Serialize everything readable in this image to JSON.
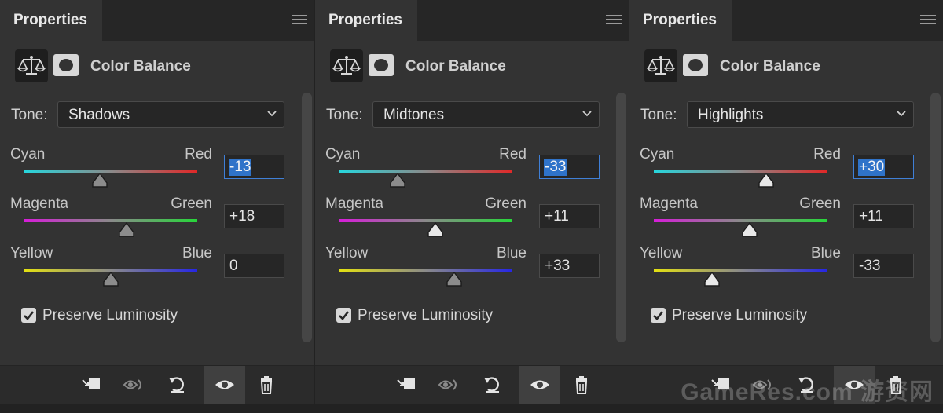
{
  "panels": [
    {
      "tab_title": "Properties",
      "adjustment_title": "Color Balance",
      "tone_label": "Tone:",
      "tone_value": "Shadows",
      "sliders": [
        {
          "left": "Cyan",
          "right": "Red",
          "value": "-13",
          "level": 0.435,
          "focused": true
        },
        {
          "left": "Magenta",
          "right": "Green",
          "value": "+18",
          "level": 0.59,
          "focused": false
        },
        {
          "left": "Yellow",
          "right": "Blue",
          "value": "0",
          "level": 0.5,
          "focused": false
        }
      ],
      "preserve_label": "Preserve Luminosity",
      "preserve_checked": true
    },
    {
      "tab_title": "Properties",
      "adjustment_title": "Color Balance",
      "tone_label": "Tone:",
      "tone_value": "Midtones",
      "sliders": [
        {
          "left": "Cyan",
          "right": "Red",
          "value": "-33",
          "level": 0.335,
          "focused": true
        },
        {
          "left": "Magenta",
          "right": "Green",
          "value": "+11",
          "level": 0.555,
          "focused": false
        },
        {
          "left": "Yellow",
          "right": "Blue",
          "value": "+33",
          "level": 0.665,
          "focused": false
        }
      ],
      "preserve_label": "Preserve Luminosity",
      "preserve_checked": true
    },
    {
      "tab_title": "Properties",
      "adjustment_title": "Color Balance",
      "tone_label": "Tone:",
      "tone_value": "Highlights",
      "sliders": [
        {
          "left": "Cyan",
          "right": "Red",
          "value": "+30",
          "level": 0.65,
          "focused": true
        },
        {
          "left": "Magenta",
          "right": "Green",
          "value": "+11",
          "level": 0.555,
          "focused": false
        },
        {
          "left": "Yellow",
          "right": "Blue",
          "value": "-33",
          "level": 0.335,
          "focused": false
        }
      ],
      "preserve_label": "Preserve Luminosity",
      "preserve_checked": true
    }
  ],
  "bottom_icons": [
    "clip-to-layer-icon",
    "view-previous-state-icon",
    "reset-icon",
    "visibility-eye-icon",
    "trash-icon"
  ],
  "watermark": "GameRes.com 游资网",
  "colors": {
    "panel_bg": "#333333",
    "field_bg": "#262626",
    "focus_blue": "#3f7fd6",
    "selection_blue": "#2f73c9"
  }
}
